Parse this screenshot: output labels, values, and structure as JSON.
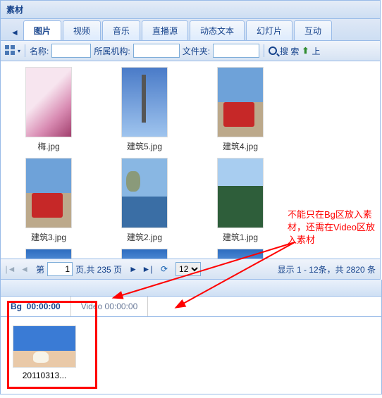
{
  "panel": {
    "title": "素材"
  },
  "tabs": {
    "items": [
      "图片",
      "视频",
      "音乐",
      "直播源",
      "动态文本",
      "幻灯片",
      "互动"
    ],
    "activeIndex": 0
  },
  "toolbar": {
    "name_label": "名称:",
    "org_label": "所属机构:",
    "folder_label": "文件夹:",
    "name_value": "",
    "org_value": "",
    "folder_value": "",
    "search_label": "搜 索",
    "upload_label": "上"
  },
  "gallery": {
    "row1": [
      {
        "label": "梅.jpg",
        "cls": "im-blossom"
      },
      {
        "label": "建筑5.jpg",
        "cls": "im-tower"
      },
      {
        "label": "建筑4.jpg",
        "cls": "im-bus"
      }
    ],
    "row2": [
      {
        "label": "建筑3.jpg",
        "cls": "im-bus"
      },
      {
        "label": "建筑2.jpg",
        "cls": "im-coast"
      },
      {
        "label": "建筑1.jpg",
        "cls": "im-mtn"
      }
    ]
  },
  "pager": {
    "prefix": "第",
    "page": "1",
    "suffix": "页,共 235 页",
    "pageSize": "12",
    "info": "显示 1 - 12条，共 2820 条"
  },
  "timeline": {
    "bg": {
      "label": "Bg",
      "time": "00:00:00"
    },
    "video": {
      "label": "Video 00:00:00"
    },
    "asset": {
      "label": "20110313..."
    }
  },
  "annotation": {
    "text": "不能只在Bg区放入素材，还需在Video区放入素材"
  }
}
